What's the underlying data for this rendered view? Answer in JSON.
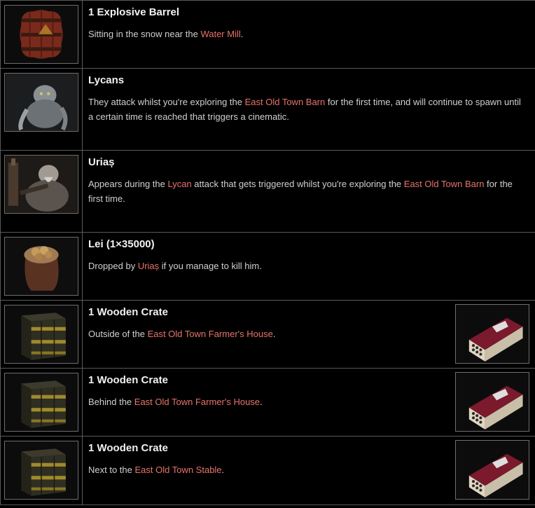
{
  "rows": [
    {
      "title": "1 Explosive Barrel",
      "image_icon": "explosive-barrel-icon",
      "desc": [
        {
          "text": "Sitting in the snow near the "
        },
        {
          "text": "Water Mill",
          "link": true
        },
        {
          "text": "."
        }
      ]
    },
    {
      "title": "Lycans",
      "image_icon": "lycan-icon",
      "desc": [
        {
          "text": "They attack whilst you're exploring the "
        },
        {
          "text": "East Old Town Barn",
          "link": true
        },
        {
          "text": " for the first time, and will continue to spawn until a certain time is reached that triggers a cinematic."
        }
      ]
    },
    {
      "title": "Uriaș",
      "image_icon": "urias-icon",
      "desc": [
        {
          "text": "Appears during the "
        },
        {
          "text": "Lycan",
          "link": true
        },
        {
          "text": " attack that gets triggered whilst you're exploring the "
        },
        {
          "text": "East Old Town Barn",
          "link": true
        },
        {
          "text": " for the first time."
        }
      ]
    },
    {
      "title": "Lei (1×35000)",
      "image_icon": "lei-bag-icon",
      "desc": [
        {
          "text": "Dropped by "
        },
        {
          "text": "Uriaș",
          "link": true
        },
        {
          "text": " if you manage to kill him."
        }
      ]
    },
    {
      "title": "1 Wooden Crate",
      "image_icon": "wooden-crate-icon",
      "side_icon": "ammo-box-icon",
      "desc": [
        {
          "text": "Outside of the "
        },
        {
          "text": "East Old Town Farmer's House",
          "link": true
        },
        {
          "text": "."
        }
      ]
    },
    {
      "title": "1 Wooden Crate",
      "image_icon": "wooden-crate-icon",
      "side_icon": "ammo-box-icon",
      "desc": [
        {
          "text": "Behind the "
        },
        {
          "text": "East Old Town Farmer's House",
          "link": true
        },
        {
          "text": "."
        }
      ]
    },
    {
      "title": "1 Wooden Crate",
      "image_icon": "wooden-crate-icon",
      "side_icon": "ammo-box-icon",
      "desc": [
        {
          "text": "Next to the "
        },
        {
          "text": "East Old Town Stable",
          "link": true
        },
        {
          "text": "."
        }
      ]
    }
  ],
  "colors": {
    "link": "#e8736b",
    "background": "#000000",
    "border": "#5a5a5a",
    "title": "#f2f2f2",
    "text": "#d0d0d0"
  }
}
